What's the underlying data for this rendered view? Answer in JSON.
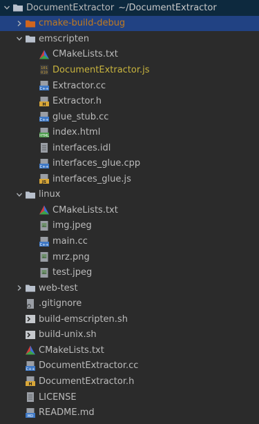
{
  "project": {
    "name": "DocumentExtractor",
    "path": "~/DocumentExtractor"
  },
  "rows": [
    {
      "name": "cmake-build-debug",
      "kind": "folder-excluded",
      "depth": 1,
      "arrow": "collapsed",
      "style": "excluded"
    },
    {
      "name": "emscripten",
      "kind": "folder",
      "depth": 1,
      "arrow": "expanded"
    },
    {
      "name": "CMakeLists.txt",
      "kind": "cmake",
      "depth": 2
    },
    {
      "name": "DocumentExtractor.js",
      "kind": "binary",
      "depth": 2,
      "style": "gen"
    },
    {
      "name": "Extractor.cc",
      "kind": "cc",
      "depth": 2
    },
    {
      "name": "Extractor.h",
      "kind": "h",
      "depth": 2
    },
    {
      "name": "glue_stub.cc",
      "kind": "cc",
      "depth": 2
    },
    {
      "name": "index.html",
      "kind": "html",
      "depth": 2
    },
    {
      "name": "interfaces.idl",
      "kind": "text",
      "depth": 2
    },
    {
      "name": "interfaces_glue.cpp",
      "kind": "cpp",
      "depth": 2
    },
    {
      "name": "interfaces_glue.js",
      "kind": "js",
      "depth": 2
    },
    {
      "name": "linux",
      "kind": "folder",
      "depth": 1,
      "arrow": "expanded"
    },
    {
      "name": "CMakeLists.txt",
      "kind": "cmake",
      "depth": 2
    },
    {
      "name": "img.jpeg",
      "kind": "image",
      "depth": 2
    },
    {
      "name": "main.cc",
      "kind": "cc",
      "depth": 2
    },
    {
      "name": "mrz.png",
      "kind": "image",
      "depth": 2
    },
    {
      "name": "test.jpeg",
      "kind": "image",
      "depth": 2
    },
    {
      "name": "web-test",
      "kind": "folder",
      "depth": 1,
      "arrow": "collapsed"
    },
    {
      "name": ".gitignore",
      "kind": "gitignore",
      "depth": 1
    },
    {
      "name": "build-emscripten.sh",
      "kind": "shell",
      "depth": 1
    },
    {
      "name": "build-unix.sh",
      "kind": "shell",
      "depth": 1
    },
    {
      "name": "CMakeLists.txt",
      "kind": "cmake",
      "depth": 1
    },
    {
      "name": "DocumentExtractor.cc",
      "kind": "cc",
      "depth": 1
    },
    {
      "name": "DocumentExtractor.h",
      "kind": "h",
      "depth": 1
    },
    {
      "name": "LICENSE",
      "kind": "text",
      "depth": 1
    },
    {
      "name": "README.md",
      "kind": "md",
      "depth": 1
    }
  ],
  "colors": {
    "background": "#2b2b2b",
    "selected_row": "#0d293e",
    "selected_folder_row": "#214283",
    "text": "#bbbbbb",
    "excluded_text": "#c07a20",
    "generated_text": "#c8b43e",
    "folder_icon": "#b8c0cc",
    "excluded_folder_icon": "#d0651e"
  },
  "icons": {
    "folder": "folder-icon",
    "folder-excluded": "excluded-folder-icon",
    "cmake": "cmake-triangle-icon",
    "binary": "binary-file-icon",
    "cc": "cpp-source-icon",
    "cpp": "cpp-source-icon",
    "h": "header-file-icon",
    "html": "html-file-icon",
    "text": "text-file-icon",
    "js": "javascript-file-icon",
    "image": "image-file-icon",
    "gitignore": "gitignore-file-icon",
    "shell": "shell-script-icon",
    "md": "markdown-file-icon"
  }
}
